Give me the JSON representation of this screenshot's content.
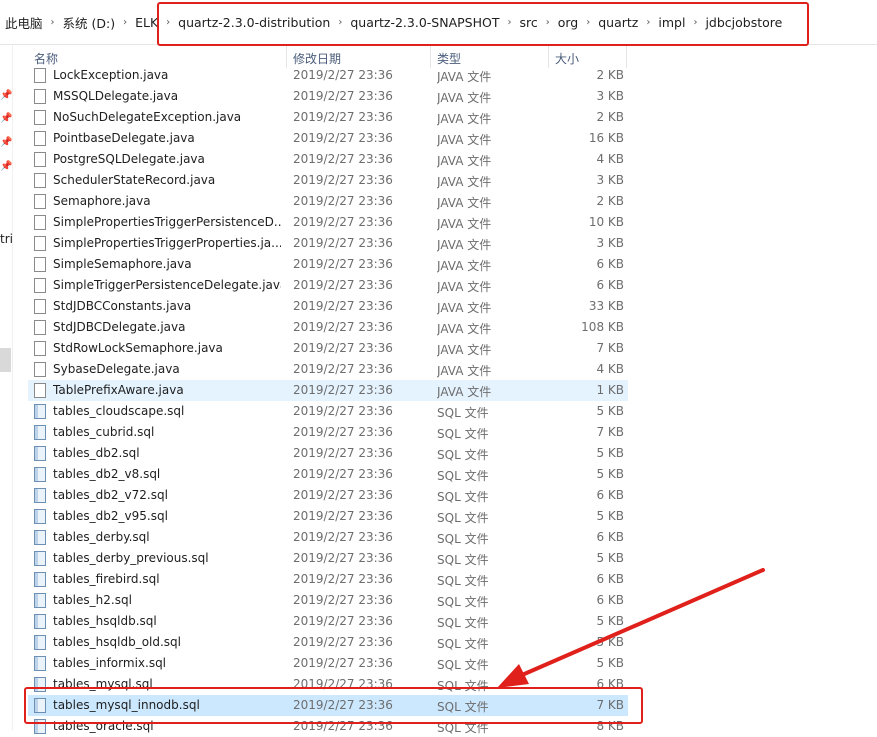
{
  "breadcrumbs": [
    "此电脑",
    "系统 (D:)",
    "ELK",
    "quartz-2.3.0-distribution",
    "quartz-2.3.0-SNAPSHOT",
    "src",
    "org",
    "quartz",
    "impl",
    "jdbcjobstore"
  ],
  "columns": {
    "name": "名称",
    "date": "修改日期",
    "type": "类型",
    "size": "大小"
  },
  "left_pane": {
    "label": "tri"
  },
  "files": [
    {
      "name": "LockException.java",
      "date": "2019/2/27 23:36",
      "type": "JAVA 文件",
      "size": "2 KB",
      "kind": "java"
    },
    {
      "name": "MSSQLDelegate.java",
      "date": "2019/2/27 23:36",
      "type": "JAVA 文件",
      "size": "3 KB",
      "kind": "java"
    },
    {
      "name": "NoSuchDelegateException.java",
      "date": "2019/2/27 23:36",
      "type": "JAVA 文件",
      "size": "2 KB",
      "kind": "java"
    },
    {
      "name": "PointbaseDelegate.java",
      "date": "2019/2/27 23:36",
      "type": "JAVA 文件",
      "size": "16 KB",
      "kind": "java"
    },
    {
      "name": "PostgreSQLDelegate.java",
      "date": "2019/2/27 23:36",
      "type": "JAVA 文件",
      "size": "4 KB",
      "kind": "java"
    },
    {
      "name": "SchedulerStateRecord.java",
      "date": "2019/2/27 23:36",
      "type": "JAVA 文件",
      "size": "3 KB",
      "kind": "java"
    },
    {
      "name": "Semaphore.java",
      "date": "2019/2/27 23:36",
      "type": "JAVA 文件",
      "size": "2 KB",
      "kind": "java"
    },
    {
      "name": "SimplePropertiesTriggerPersistenceD...",
      "date": "2019/2/27 23:36",
      "type": "JAVA 文件",
      "size": "10 KB",
      "kind": "java"
    },
    {
      "name": "SimplePropertiesTriggerProperties.ja...",
      "date": "2019/2/27 23:36",
      "type": "JAVA 文件",
      "size": "3 KB",
      "kind": "java"
    },
    {
      "name": "SimpleSemaphore.java",
      "date": "2019/2/27 23:36",
      "type": "JAVA 文件",
      "size": "6 KB",
      "kind": "java"
    },
    {
      "name": "SimpleTriggerPersistenceDelegate.java",
      "date": "2019/2/27 23:36",
      "type": "JAVA 文件",
      "size": "6 KB",
      "kind": "java"
    },
    {
      "name": "StdJDBCConstants.java",
      "date": "2019/2/27 23:36",
      "type": "JAVA 文件",
      "size": "33 KB",
      "kind": "java"
    },
    {
      "name": "StdJDBCDelegate.java",
      "date": "2019/2/27 23:36",
      "type": "JAVA 文件",
      "size": "108 KB",
      "kind": "java"
    },
    {
      "name": "StdRowLockSemaphore.java",
      "date": "2019/2/27 23:36",
      "type": "JAVA 文件",
      "size": "7 KB",
      "kind": "java"
    },
    {
      "name": "SybaseDelegate.java",
      "date": "2019/2/27 23:36",
      "type": "JAVA 文件",
      "size": "4 KB",
      "kind": "java"
    },
    {
      "name": "TablePrefixAware.java",
      "date": "2019/2/27 23:36",
      "type": "JAVA 文件",
      "size": "1 KB",
      "kind": "java",
      "state": "hover"
    },
    {
      "name": "tables_cloudscape.sql",
      "date": "2019/2/27 23:36",
      "type": "SQL 文件",
      "size": "5 KB",
      "kind": "sql"
    },
    {
      "name": "tables_cubrid.sql",
      "date": "2019/2/27 23:36",
      "type": "SQL 文件",
      "size": "7 KB",
      "kind": "sql"
    },
    {
      "name": "tables_db2.sql",
      "date": "2019/2/27 23:36",
      "type": "SQL 文件",
      "size": "5 KB",
      "kind": "sql"
    },
    {
      "name": "tables_db2_v8.sql",
      "date": "2019/2/27 23:36",
      "type": "SQL 文件",
      "size": "5 KB",
      "kind": "sql"
    },
    {
      "name": "tables_db2_v72.sql",
      "date": "2019/2/27 23:36",
      "type": "SQL 文件",
      "size": "6 KB",
      "kind": "sql"
    },
    {
      "name": "tables_db2_v95.sql",
      "date": "2019/2/27 23:36",
      "type": "SQL 文件",
      "size": "5 KB",
      "kind": "sql"
    },
    {
      "name": "tables_derby.sql",
      "date": "2019/2/27 23:36",
      "type": "SQL 文件",
      "size": "6 KB",
      "kind": "sql"
    },
    {
      "name": "tables_derby_previous.sql",
      "date": "2019/2/27 23:36",
      "type": "SQL 文件",
      "size": "5 KB",
      "kind": "sql"
    },
    {
      "name": "tables_firebird.sql",
      "date": "2019/2/27 23:36",
      "type": "SQL 文件",
      "size": "6 KB",
      "kind": "sql"
    },
    {
      "name": "tables_h2.sql",
      "date": "2019/2/27 23:36",
      "type": "SQL 文件",
      "size": "6 KB",
      "kind": "sql"
    },
    {
      "name": "tables_hsqldb.sql",
      "date": "2019/2/27 23:36",
      "type": "SQL 文件",
      "size": "5 KB",
      "kind": "sql"
    },
    {
      "name": "tables_hsqldb_old.sql",
      "date": "2019/2/27 23:36",
      "type": "SQL 文件",
      "size": "5 KB",
      "kind": "sql"
    },
    {
      "name": "tables_informix.sql",
      "date": "2019/2/27 23:36",
      "type": "SQL 文件",
      "size": "5 KB",
      "kind": "sql"
    },
    {
      "name": "tables_mysql.sql",
      "date": "2019/2/27 23:36",
      "type": "SQL 文件",
      "size": "6 KB",
      "kind": "sql"
    },
    {
      "name": "tables_mysql_innodb.sql",
      "date": "2019/2/27 23:36",
      "type": "SQL 文件",
      "size": "7 KB",
      "kind": "sql",
      "state": "selected"
    },
    {
      "name": "tables_oracle.sql",
      "date": "2019/2/27 23:36",
      "type": "SQL 文件",
      "size": "8 KB",
      "kind": "sql"
    }
  ],
  "colors": {
    "highlight": "#e0211b",
    "selected_row": "#cce8ff",
    "hover_row": "#e5f3ff"
  }
}
